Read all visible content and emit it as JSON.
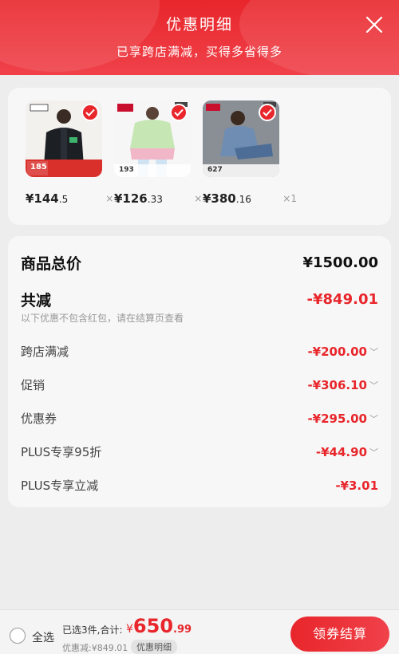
{
  "header": {
    "title": "优惠明细",
    "subtitle": "已享跨店满减，买得多省得多"
  },
  "products": [
    {
      "price_int": "¥144",
      "price_dec": ".5",
      "qty": "×1",
      "badge": "185"
    },
    {
      "price_int": "¥126",
      "price_dec": ".33",
      "qty": "×1",
      "badge": "193"
    },
    {
      "price_int": "¥380",
      "price_dec": ".16",
      "qty": "×1",
      "badge": "627"
    }
  ],
  "summary": {
    "total_label": "商品总价",
    "total_value": "¥1500.00",
    "reduced_label": "共减",
    "reduced_value": "-¥849.01",
    "note": "以下优惠不包含红包，请在结算页查看",
    "items": [
      {
        "label": "跨店满减",
        "value": "-¥200.00"
      },
      {
        "label": "促销",
        "value": "-¥306.10"
      },
      {
        "label": "优惠券",
        "value": "-¥295.00"
      },
      {
        "label": "PLUS专享95折",
        "value": "-¥44.90"
      },
      {
        "label": "PLUS专享立减",
        "value": "-¥3.01"
      }
    ]
  },
  "bottom": {
    "select_all": "全选",
    "selected_info": "已选3件,合计:",
    "amount_yen": "¥",
    "amount_int": "650",
    "amount_dec": ".99",
    "reduced": "优惠减:¥849.01",
    "detail_chip": "优惠明细",
    "checkout": "领券结算"
  },
  "colors": {
    "accent": "#e8262b"
  }
}
